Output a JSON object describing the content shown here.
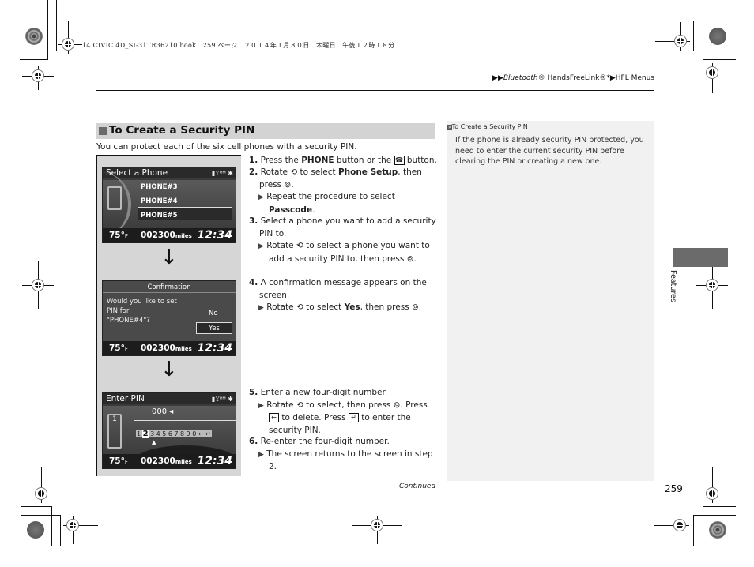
{
  "print_header": "14 CIVIC 4D_SI-31TR36210.book　259 ページ　２０１４年１月３０日　木曜日　午後１２時１８分",
  "breadcrumb": {
    "items": [
      "Bluetooth® HandsFreeLink®*",
      "HFL Menus"
    ],
    "first_italic_part": "Bluetooth",
    "first_rest": "® HandsFreeLink®*"
  },
  "section": {
    "title": "To Create a Security PIN",
    "intro": "You can protect each of the six cell phones with a security PIN."
  },
  "screens": [
    {
      "title": "Select a Phone",
      "status_icons": "battery signal RM bluetooth",
      "items": [
        "PHONE#3",
        "PHONE#4",
        "PHONE#5"
      ],
      "selected": "PHONE#4",
      "temp": "75°",
      "temp_unit": "F",
      "odometer": "002300",
      "odo_unit": "miles",
      "clock": "12:34"
    },
    {
      "title": "Confirmation",
      "message_lines": [
        "Would you like to set",
        "PIN for",
        "\"PHONE#4\"?"
      ],
      "options": [
        "No",
        "Yes"
      ],
      "selected": "Yes",
      "temp": "75°",
      "temp_unit": "F",
      "odometer": "002300",
      "odo_unit": "miles",
      "clock": "12:34"
    },
    {
      "title": "Enter PIN",
      "status_icons": "battery signal RM bluetooth",
      "entry": "000",
      "phone_slot": "1",
      "digits": [
        "1",
        "2",
        "3",
        "4",
        "5",
        "6",
        "7",
        "8",
        "9",
        "0"
      ],
      "selected_digit": "2",
      "temp": "75°",
      "temp_unit": "F",
      "odometer": "002300",
      "odo_unit": "miles",
      "clock": "12:34"
    }
  ],
  "steps": [
    {
      "num": "1.",
      "parts": [
        "Press the ",
        "PHONE",
        " button or the ",
        " button."
      ]
    },
    {
      "num": "2.",
      "text_a": "Rotate ",
      "text_b": " to select ",
      "bold": "Phone Setup",
      "text_c": ", then",
      "line2": "press ",
      "sub_a": "Repeat the procedure to select",
      "sub_bold": "Passcode",
      "sub_end": "."
    },
    {
      "num": "3.",
      "text": "Select a phone you want to add a security",
      "line2": "PIN to.",
      "sub_a": "Rotate ",
      "sub_b": " to select a phone you want to",
      "sub_line2": "add a security PIN to, then press "
    },
    {
      "num": "4.",
      "text": "A confirmation message appears on the",
      "line2": "screen.",
      "sub_a": "Rotate ",
      "sub_b": " to select ",
      "sub_bold": "Yes",
      "sub_c": ", then press "
    },
    {
      "num": "5.",
      "text": "Enter a new four-digit number.",
      "sub_a": "Rotate ",
      "sub_b": " to select, then press ",
      "sub_c": ". Press",
      "sub_line2a": " to delete. Press ",
      "sub_line2b": " to enter the",
      "sub_line3": "security PIN."
    },
    {
      "num": "6.",
      "text": "Re-enter the four-digit number.",
      "sub_a": "The screen returns to the screen in step",
      "sub_line2": "2."
    }
  ],
  "note": {
    "title": "To Create a Security PIN",
    "text": "If the phone is already security PIN protected, you need to enter the current security PIN before clearing the PIN or creating a new one."
  },
  "footer": {
    "continued": "Continued",
    "page_number": "259",
    "side_tab_label": "Features"
  }
}
